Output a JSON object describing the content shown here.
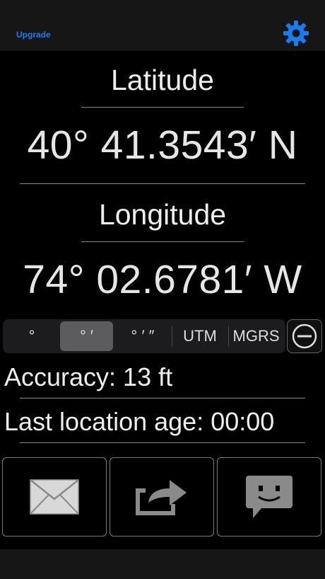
{
  "header": {
    "upgrade_label": "Upgrade",
    "settings_icon": "gear-icon"
  },
  "latitude": {
    "label": "Latitude",
    "value": "40° 41.3543′ N"
  },
  "longitude": {
    "label": "Longitude",
    "value": "74° 02.6781′ W"
  },
  "format_selector": {
    "options": [
      "°",
      "° ′",
      "° ′ ″",
      "UTM",
      "MGRS"
    ],
    "selected": "° ′",
    "minus_icon": "minus-circle-icon"
  },
  "status": {
    "accuracy": "Accuracy: 13 ft",
    "age": "Last location age: 00:00"
  },
  "actions": {
    "email_icon": "envelope-icon",
    "share_icon": "share-icon",
    "message_icon": "message-bubble-icon"
  },
  "colors": {
    "accent": "#1a7cf0",
    "background": "#000000",
    "bar": "#161616"
  }
}
